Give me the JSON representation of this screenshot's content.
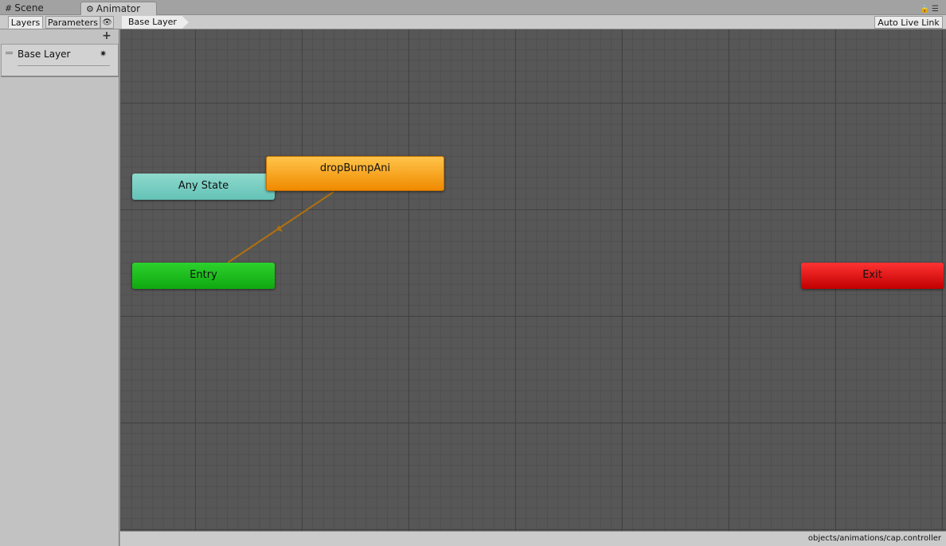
{
  "window_tabs": [
    {
      "label": "Scene",
      "icon": "grid-icon"
    },
    {
      "label": "Animator",
      "icon": "animator-icon"
    }
  ],
  "toolbar": {
    "layers_tab": "Layers",
    "parameters_tab": "Parameters",
    "breadcrumb": "Base Layer",
    "live_link": "Auto Live Link"
  },
  "layers": [
    {
      "name": "Base Layer"
    }
  ],
  "graph": {
    "nodes": {
      "any_state": "Any State",
      "entry": "Entry",
      "exit": "Exit",
      "state": "dropBumpAni"
    },
    "colors": {
      "any_state": "#6fcabd",
      "entry": "#1ebf1e",
      "exit": "#e01010",
      "default_state": "#f5a020",
      "transition": "#b07010"
    }
  },
  "status": {
    "path": "objects/animations/cap.controller"
  }
}
